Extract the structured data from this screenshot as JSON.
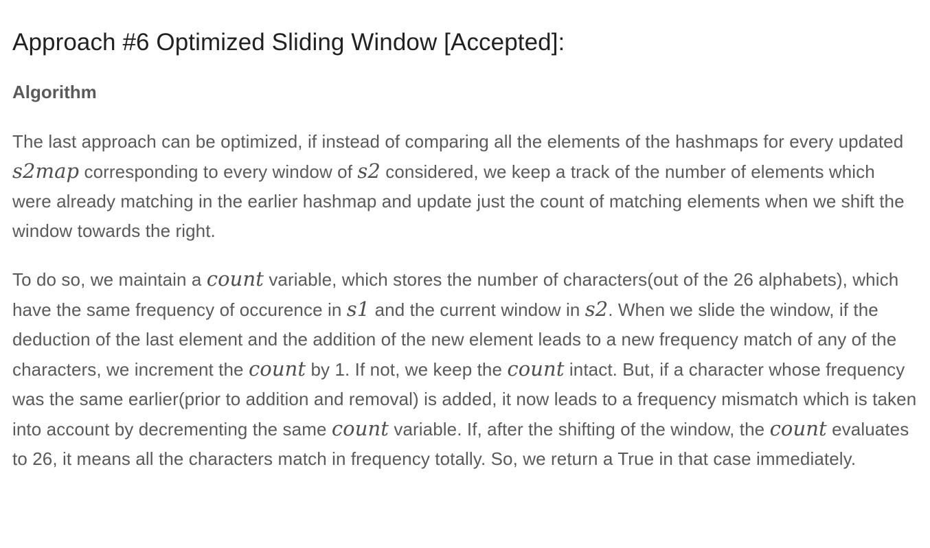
{
  "heading": "Approach #6 Optimized Sliding Window [Accepted]:",
  "subheading": "Algorithm",
  "paragraph1": {
    "t1": "The last approach can be optimized, if instead of comparing all the elements of the hashmaps for every updated ",
    "m1": "s2map",
    "t2": " corresponding to every window of ",
    "m2": "s2",
    "t3": " considered, we keep a track of the number of elements which were already matching in the earlier hashmap and update just the count of matching elements when we shift the window towards the right."
  },
  "paragraph2": {
    "t1": "To do so, we maintain a ",
    "m1": "count",
    "t2": " variable, which stores the number of characters(out of the 26 alphabets), which have the same frequency of occurence in ",
    "m2": "s1",
    "t3": " and the current window in ",
    "m3": "s2",
    "t4": ". When we slide the window, if the deduction of the last element and the addition of the new element leads to a new frequency match of any of the characters, we increment the ",
    "m4": "count",
    "t5": " by 1. If not, we keep the ",
    "m5": "count",
    "t6": " intact. But, if a character whose frequency was the same earlier(prior to addition and removal) is added, it now leads to a frequency mismatch which is taken into account by decrementing the same ",
    "m6": "count",
    "t7": " variable. If, after the shifting of the window, the ",
    "m7": "count",
    "t8": " evaluates to 26, it means all the characters match in frequency totally. So, we return a True in that case immediately."
  }
}
